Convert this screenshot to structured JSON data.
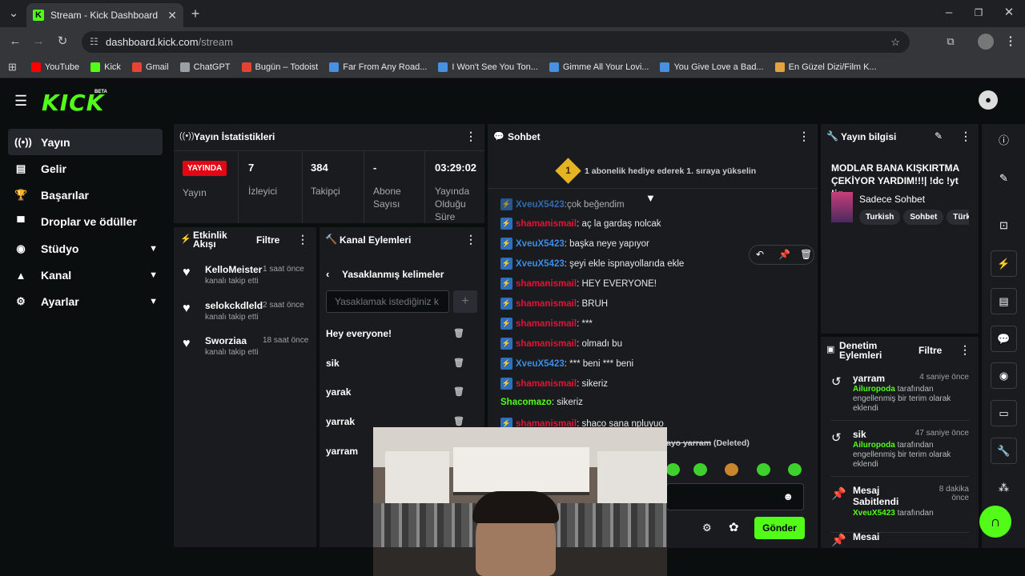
{
  "browser": {
    "tab_title": "Stream - Kick Dashboard",
    "url_host": "dashboard.kick.com",
    "url_path": "/stream",
    "bookmarks": [
      {
        "label": "YouTube",
        "color": "#ff0000"
      },
      {
        "label": "Kick",
        "color": "#53fc18"
      },
      {
        "label": "Gmail",
        "color": "#ea4335"
      },
      {
        "label": "ChatGPT",
        "color": "#9aa0a6"
      },
      {
        "label": "Bugün – Todoist",
        "color": "#e44332"
      },
      {
        "label": "Far From Any Road...",
        "color": "#4a90e2"
      },
      {
        "label": "I Won't See You Ton...",
        "color": "#4a90e2"
      },
      {
        "label": "Gimme All Your Lovi...",
        "color": "#4a90e2"
      },
      {
        "label": "You Give Love a Bad...",
        "color": "#4a90e2"
      },
      {
        "label": "En Güzel Dizi/Film K...",
        "color": "#e6a23c"
      }
    ]
  },
  "app": {
    "logo": "KICK",
    "beta": "BETA",
    "accent": "#53fc18"
  },
  "nav": [
    {
      "label": "Yayın",
      "icon": "broadcast-icon",
      "glyph": "((•))",
      "active": true
    },
    {
      "label": "Gelir",
      "icon": "revenue-icon",
      "glyph": "▤"
    },
    {
      "label": "Başarılar",
      "icon": "trophy-icon",
      "glyph": "🏆"
    },
    {
      "label": "Droplar ve ödüller",
      "icon": "drops-icon",
      "glyph": "▀"
    },
    {
      "label": "Stüdyo",
      "icon": "studio-icon",
      "glyph": "◉",
      "expandable": true
    },
    {
      "label": "Kanal",
      "icon": "channel-icon",
      "glyph": "▲",
      "expandable": true
    },
    {
      "label": "Ayarlar",
      "icon": "settings-icon",
      "glyph": "⚙",
      "expandable": true
    }
  ],
  "stats": {
    "title": "Yayın İstatistikleri",
    "live_badge": "YAYINDA",
    "live_label": "Yayın",
    "viewers": {
      "value": "7",
      "label": "İzleyici"
    },
    "followers": {
      "value": "384",
      "label": "Takipçi"
    },
    "subs": {
      "value": "-",
      "label": "Abone Sayısı"
    },
    "duration": {
      "value": "03:29:02",
      "label": "Yayında Olduğu Süre"
    }
  },
  "activity": {
    "title": "Etkinlik Akışı",
    "filter": "Filtre",
    "items": [
      {
        "name": "KelloMeister",
        "time": "1 saat önce",
        "action": "kanalı takip etti"
      },
      {
        "name": "selokckdleld",
        "time": "2 saat önce",
        "action": "kanalı takip etti"
      },
      {
        "name": "Sworziaa",
        "time": "18 saat önce",
        "action": "kanalı takip etti"
      }
    ]
  },
  "channel_actions": {
    "title": "Kanal Eylemleri",
    "section": "Yasaklanmış kelimeler",
    "input_placeholder": "Yasaklamak istediğiniz k",
    "add": "+",
    "words": [
      "Hey everyone!",
      "sik",
      "yarak",
      "yarrak",
      "yarram"
    ]
  },
  "chat": {
    "title": "Sohbet",
    "rank_badge": "1",
    "banner": "1 abonelik hediye ederek 1. sıraya yükselin",
    "partial_top": "çok beğendim",
    "partial_user": "XveuX5423",
    "messages": [
      {
        "user": "shamanismail",
        "color": "red",
        "text": ": aç la gardaş nolcak"
      },
      {
        "user": "XveuX5423",
        "color": "blue",
        "text": ": başka neye yapıyor"
      },
      {
        "user": "XveuX5423",
        "color": "blue",
        "text": ": şeyi ekle ispnayollarıda ekle"
      },
      {
        "user": "shamanismail",
        "color": "red",
        "text": ": HEY EVERYONE!"
      },
      {
        "user": "shamanismail",
        "color": "red",
        "text": ": BRUH"
      },
      {
        "user": "shamanismail",
        "color": "red",
        "text": ": ***"
      },
      {
        "user": "shamanismail",
        "color": "red",
        "text": ": olmadı bu"
      },
      {
        "user": "XveuX5423",
        "color": "blue",
        "text": ": *** beni *** beni"
      },
      {
        "user": "shamanismail",
        "color": "red",
        "text": ": sikeriz"
      },
      {
        "user": "Shacomazo",
        "color": "green",
        "text": ": sikeriz",
        "nobadge": true
      },
      {
        "user": "shamanismail",
        "color": "red",
        "text": ": shaco sana npluyuo"
      }
    ],
    "deleted_text": "ayo yarram",
    "deleted_label": "(Deleted)",
    "send": "Gönder"
  },
  "stream_info": {
    "title": "Yayın bilgisi",
    "stream_title": "MODLAR BANA KIŞKIRTMA ÇEKİYOR YARDIM!!!| !dc !yt !ig",
    "category": "Sadece Sohbet",
    "tags": [
      "Turkish",
      "Sohbet",
      "Türk"
    ]
  },
  "moderation": {
    "title": "Denetim Eylemleri",
    "filter": "Filtre",
    "items": [
      {
        "name": "yarram",
        "time": "4 saniye önce",
        "mod": "Ailuropoda",
        "desc": "tarafından engellenmiş bir terim olarak eklendi",
        "icon": "undo-icon"
      },
      {
        "name": "sik",
        "time": "47 saniye önce",
        "mod": "Ailuropoda",
        "desc": "tarafından engellenmiş bir terim olarak eklendi",
        "icon": "undo-icon"
      },
      {
        "name": "Mesaj Sabitlendi",
        "time": "8 dakika önce",
        "mod": "XveuX5423",
        "desc": "tarafından",
        "icon": "pin-icon"
      },
      {
        "name": "Mesai",
        "time": "",
        "mod": "",
        "desc": "",
        "icon": "pin-icon"
      }
    ]
  }
}
